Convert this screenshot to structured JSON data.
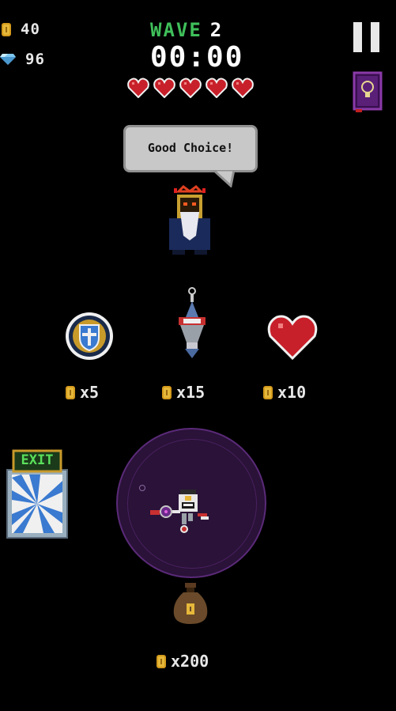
{
  "hud": {
    "coins": "40",
    "gems": "96",
    "wave_label": "WAVE",
    "wave_number": "2",
    "timer": "00:00",
    "hearts": 5
  },
  "merchant": {
    "speech": "Good Choice!"
  },
  "shop": {
    "items": [
      {
        "name": "shield",
        "price": "x5"
      },
      {
        "name": "rocket-turret",
        "price": "x15"
      },
      {
        "name": "heart",
        "price": "x10"
      }
    ],
    "exit_label": "EXIT",
    "bag_price": "x200"
  },
  "colors": {
    "wave_green": "#3fbf5a",
    "heart_red": "#c8202a",
    "portal_purple": "#2a1238",
    "coin_gold": "#e6b83a"
  }
}
